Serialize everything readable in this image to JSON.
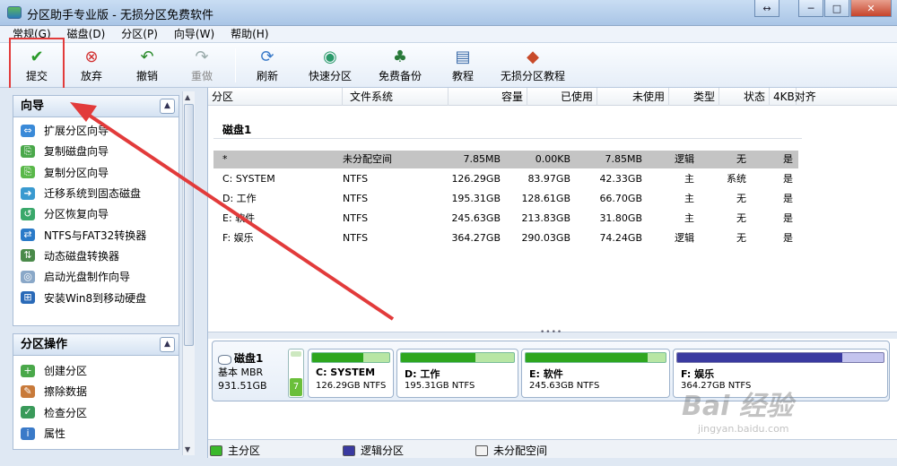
{
  "window": {
    "title": "分区助手专业版 - 无损分区免费软件",
    "buttons": {
      "restore": "↔",
      "minimize": "─",
      "maximize": "□",
      "close": "✕"
    }
  },
  "menu": [
    "常规(G)",
    "磁盘(D)",
    "分区(P)",
    "向导(W)",
    "帮助(H)"
  ],
  "toolbar": {
    "commit": "提交",
    "discard": "放弃",
    "undo": "撤销",
    "redo": "重做",
    "refresh": "刷新",
    "quick_partition": "快速分区",
    "free_backup": "免费备份",
    "tutorial": "教程",
    "lossless_tutorial": "无损分区教程"
  },
  "wizard_panel": {
    "title": "向导",
    "items": [
      "扩展分区向导",
      "复制磁盘向导",
      "复制分区向导",
      "迁移系统到固态磁盘",
      "分区恢复向导",
      "NTFS与FAT32转换器",
      "动态磁盘转换器",
      "启动光盘制作向导",
      "安装Win8到移动硬盘"
    ]
  },
  "partition_panel": {
    "title": "分区操作",
    "items": [
      "创建分区",
      "擦除数据",
      "检查分区",
      "属性"
    ]
  },
  "table": {
    "columns": [
      "分区",
      "文件系统",
      "容量",
      "已使用",
      "未使用",
      "类型",
      "状态",
      "4KB对齐"
    ],
    "disk_label": "磁盘1",
    "rows": [
      [
        "*",
        "未分配空间",
        "7.85MB",
        "0.00KB",
        "7.85MB",
        "逻辑",
        "无",
        "是"
      ],
      [
        "C: SYSTEM",
        "NTFS",
        "126.29GB",
        "83.97GB",
        "42.33GB",
        "主",
        "系统",
        "是"
      ],
      [
        "D: 工作",
        "NTFS",
        "195.31GB",
        "128.61GB",
        "66.70GB",
        "主",
        "无",
        "是"
      ],
      [
        "E: 软件",
        "NTFS",
        "245.63GB",
        "213.83GB",
        "31.80GB",
        "主",
        "无",
        "是"
      ],
      [
        "F: 娱乐",
        "NTFS",
        "364.27GB",
        "290.03GB",
        "74.24GB",
        "逻辑",
        "无",
        "是"
      ]
    ]
  },
  "disk_map": {
    "name": "磁盘1",
    "type": "基本 MBR",
    "size": "931.51GB",
    "unalloc_number": "7",
    "partitions": [
      {
        "name": "C: SYSTEM",
        "info": "126.29GB NTFS",
        "used": 0.66,
        "kind": "primary"
      },
      {
        "name": "D: 工作",
        "info": "195.31GB NTFS",
        "used": 0.66,
        "kind": "primary"
      },
      {
        "name": "E: 软件",
        "info": "245.63GB NTFS",
        "used": 0.87,
        "kind": "primary"
      },
      {
        "name": "F: 娱乐",
        "info": "364.27GB NTFS",
        "used": 0.8,
        "kind": "logical"
      }
    ]
  },
  "legend": {
    "primary": "主分区",
    "logical": "逻辑分区",
    "unallocated": "未分配空间"
  },
  "watermark": {
    "logo": "Bai 经验",
    "url": "jingyan.baidu.com"
  },
  "colors": {
    "highlight": "#e23b3b",
    "primary": "#2ea61e",
    "logical": "#3a3aa0"
  }
}
